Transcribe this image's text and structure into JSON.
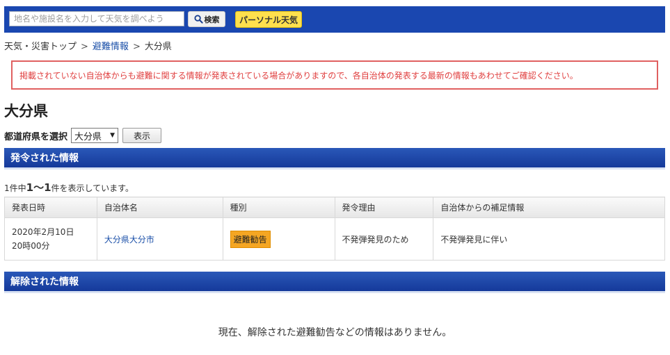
{
  "search": {
    "placeholder": "地名や施設名を入力して天気を調べよう",
    "button_label": "検索",
    "personal_label": "パーソナル天気"
  },
  "breadcrumb": {
    "items": [
      "天気・災害トップ",
      "避難情報",
      "大分県"
    ],
    "separator": ">"
  },
  "notice": "掲載されていない自治体からも避難に関する情報が発表されている場合がありますので、各自治体の発表する最新の情報もあわせてご確認ください。",
  "page_title": "大分県",
  "prefecture": {
    "label": "都道府県を選択",
    "selected": "大分県",
    "show_label": "表示"
  },
  "issued": {
    "header": "発令された情報",
    "count_prefix": "1件中",
    "count_range": "1〜1",
    "count_suffix": "件を表示しています。",
    "columns": [
      "発表日時",
      "自治体名",
      "種別",
      "発令理由",
      "自治体からの補足情報"
    ],
    "rows": [
      {
        "date_line1": "2020年2月10日",
        "date_line2": "20時00分",
        "municipality": "大分県大分市",
        "type": "避難勧告",
        "reason": "不発弾発見のため",
        "supplement": "不発弾発見に伴い"
      }
    ]
  },
  "lifted": {
    "header": "解除された情報",
    "empty_message": "現在、解除された避難勧告などの情報はありません。"
  },
  "colors": {
    "brand_blue": "#1a47b0",
    "personal_yellow": "#ffe04d",
    "notice_red": "#e04040",
    "badge_orange": "#f5a623",
    "link_blue": "#1a4fa8"
  }
}
